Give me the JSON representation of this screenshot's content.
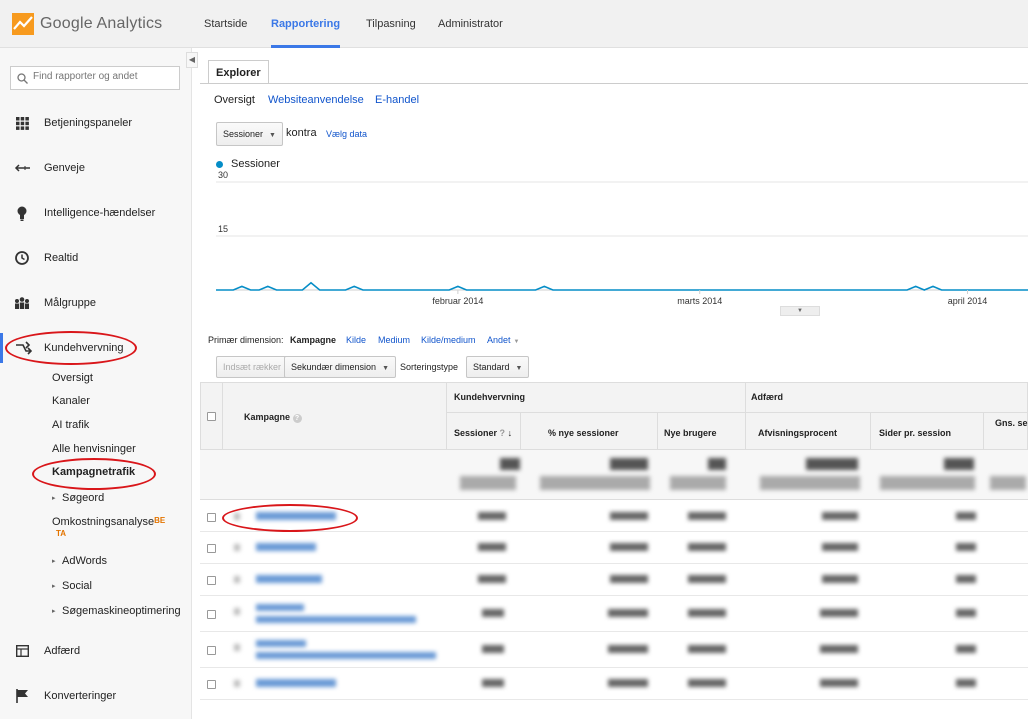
{
  "header": {
    "logo_text": "Google Analytics",
    "nav": [
      "Startside",
      "Rapportering",
      "Tilpasning",
      "Administrator"
    ],
    "active_nav": "Rapportering"
  },
  "sidebar": {
    "search_placeholder": "Find rapporter og andet",
    "items": [
      {
        "label": "Betjeningspaneler",
        "icon": "grid-icon"
      },
      {
        "label": "Genveje",
        "icon": "shortcut-arrow-icon"
      },
      {
        "label": "Intelligence-hændelser",
        "icon": "bulb-icon"
      },
      {
        "label": "Realtid",
        "icon": "clock-icon"
      },
      {
        "label": "Målgruppe",
        "icon": "people-icon"
      },
      {
        "label": "Kundehvervning",
        "icon": "acquisition-arrows-icon"
      }
    ],
    "sub_items": [
      "Oversigt",
      "Kanaler",
      "AI trafik",
      "Alle henvisninger",
      "Kampagnetrafik",
      "Søgeord",
      "Omkostningsanalyse",
      "AdWords",
      "Social",
      "Søgemaskineoptimering"
    ],
    "beta_label_1": "BE",
    "beta_label_2": "TA",
    "bottom_items": [
      {
        "label": "Adfærd",
        "icon": "behavior-icon"
      },
      {
        "label": "Konverteringer",
        "icon": "flag-icon"
      }
    ]
  },
  "explorer": {
    "tab": "Explorer",
    "subtabs": [
      "Oversigt",
      "Websiteanvendelse",
      "E-handel"
    ],
    "metric_select": "Sessioner",
    "versus": "kontra",
    "choose_metric": "Vælg data",
    "legend": "Sessioner",
    "series_color": "#058dc7"
  },
  "chart_data": {
    "type": "line",
    "series": [
      {
        "name": "Sessioner",
        "values": [
          0,
          0,
          0,
          1,
          0,
          0,
          1,
          0,
          0,
          0,
          0,
          2,
          0,
          0,
          0,
          0,
          1,
          0,
          0,
          0,
          0,
          0,
          0,
          0,
          0,
          0,
          0,
          0,
          1,
          0,
          0,
          0,
          0,
          0,
          0,
          0,
          0,
          0,
          1,
          0,
          0,
          0,
          0,
          0,
          0,
          0,
          0,
          0,
          0,
          0,
          0,
          0,
          0,
          0,
          0,
          0,
          0,
          0,
          0,
          0,
          0,
          0,
          0,
          0,
          0,
          0,
          0,
          0,
          0,
          0,
          0,
          0,
          0,
          0,
          0,
          0,
          0,
          0,
          0,
          0,
          0,
          1,
          0,
          1,
          0,
          0,
          0,
          0,
          0,
          0,
          0,
          0,
          0,
          0,
          0
        ]
      }
    ],
    "yticks": [
      15,
      30
    ],
    "ylim": [
      0,
      30
    ],
    "xtick_labels": [
      "februar 2014",
      "marts 2014",
      "april 2014"
    ],
    "grid": true
  },
  "dimensions": {
    "label": "Primær dimension:",
    "active": "Kampagne",
    "links": [
      "Kilde",
      "Medium",
      "Kilde/medium",
      "Andet"
    ]
  },
  "toolbar": {
    "plot_rows": "Indsæt rækker",
    "secondary_dim": "Sekundær dimension",
    "sort_label": "Sorteringstype",
    "sort_value": "Standard"
  },
  "table": {
    "col_campaign": "Kampagne",
    "group_acquisition": "Kundehvervning",
    "group_behavior": "Adfærd",
    "cols": [
      "Sessioner",
      "% nye sessioner",
      "Nye brugere",
      "Afvisningsprocent",
      "Sider pr. session",
      "Gns. se"
    ]
  }
}
